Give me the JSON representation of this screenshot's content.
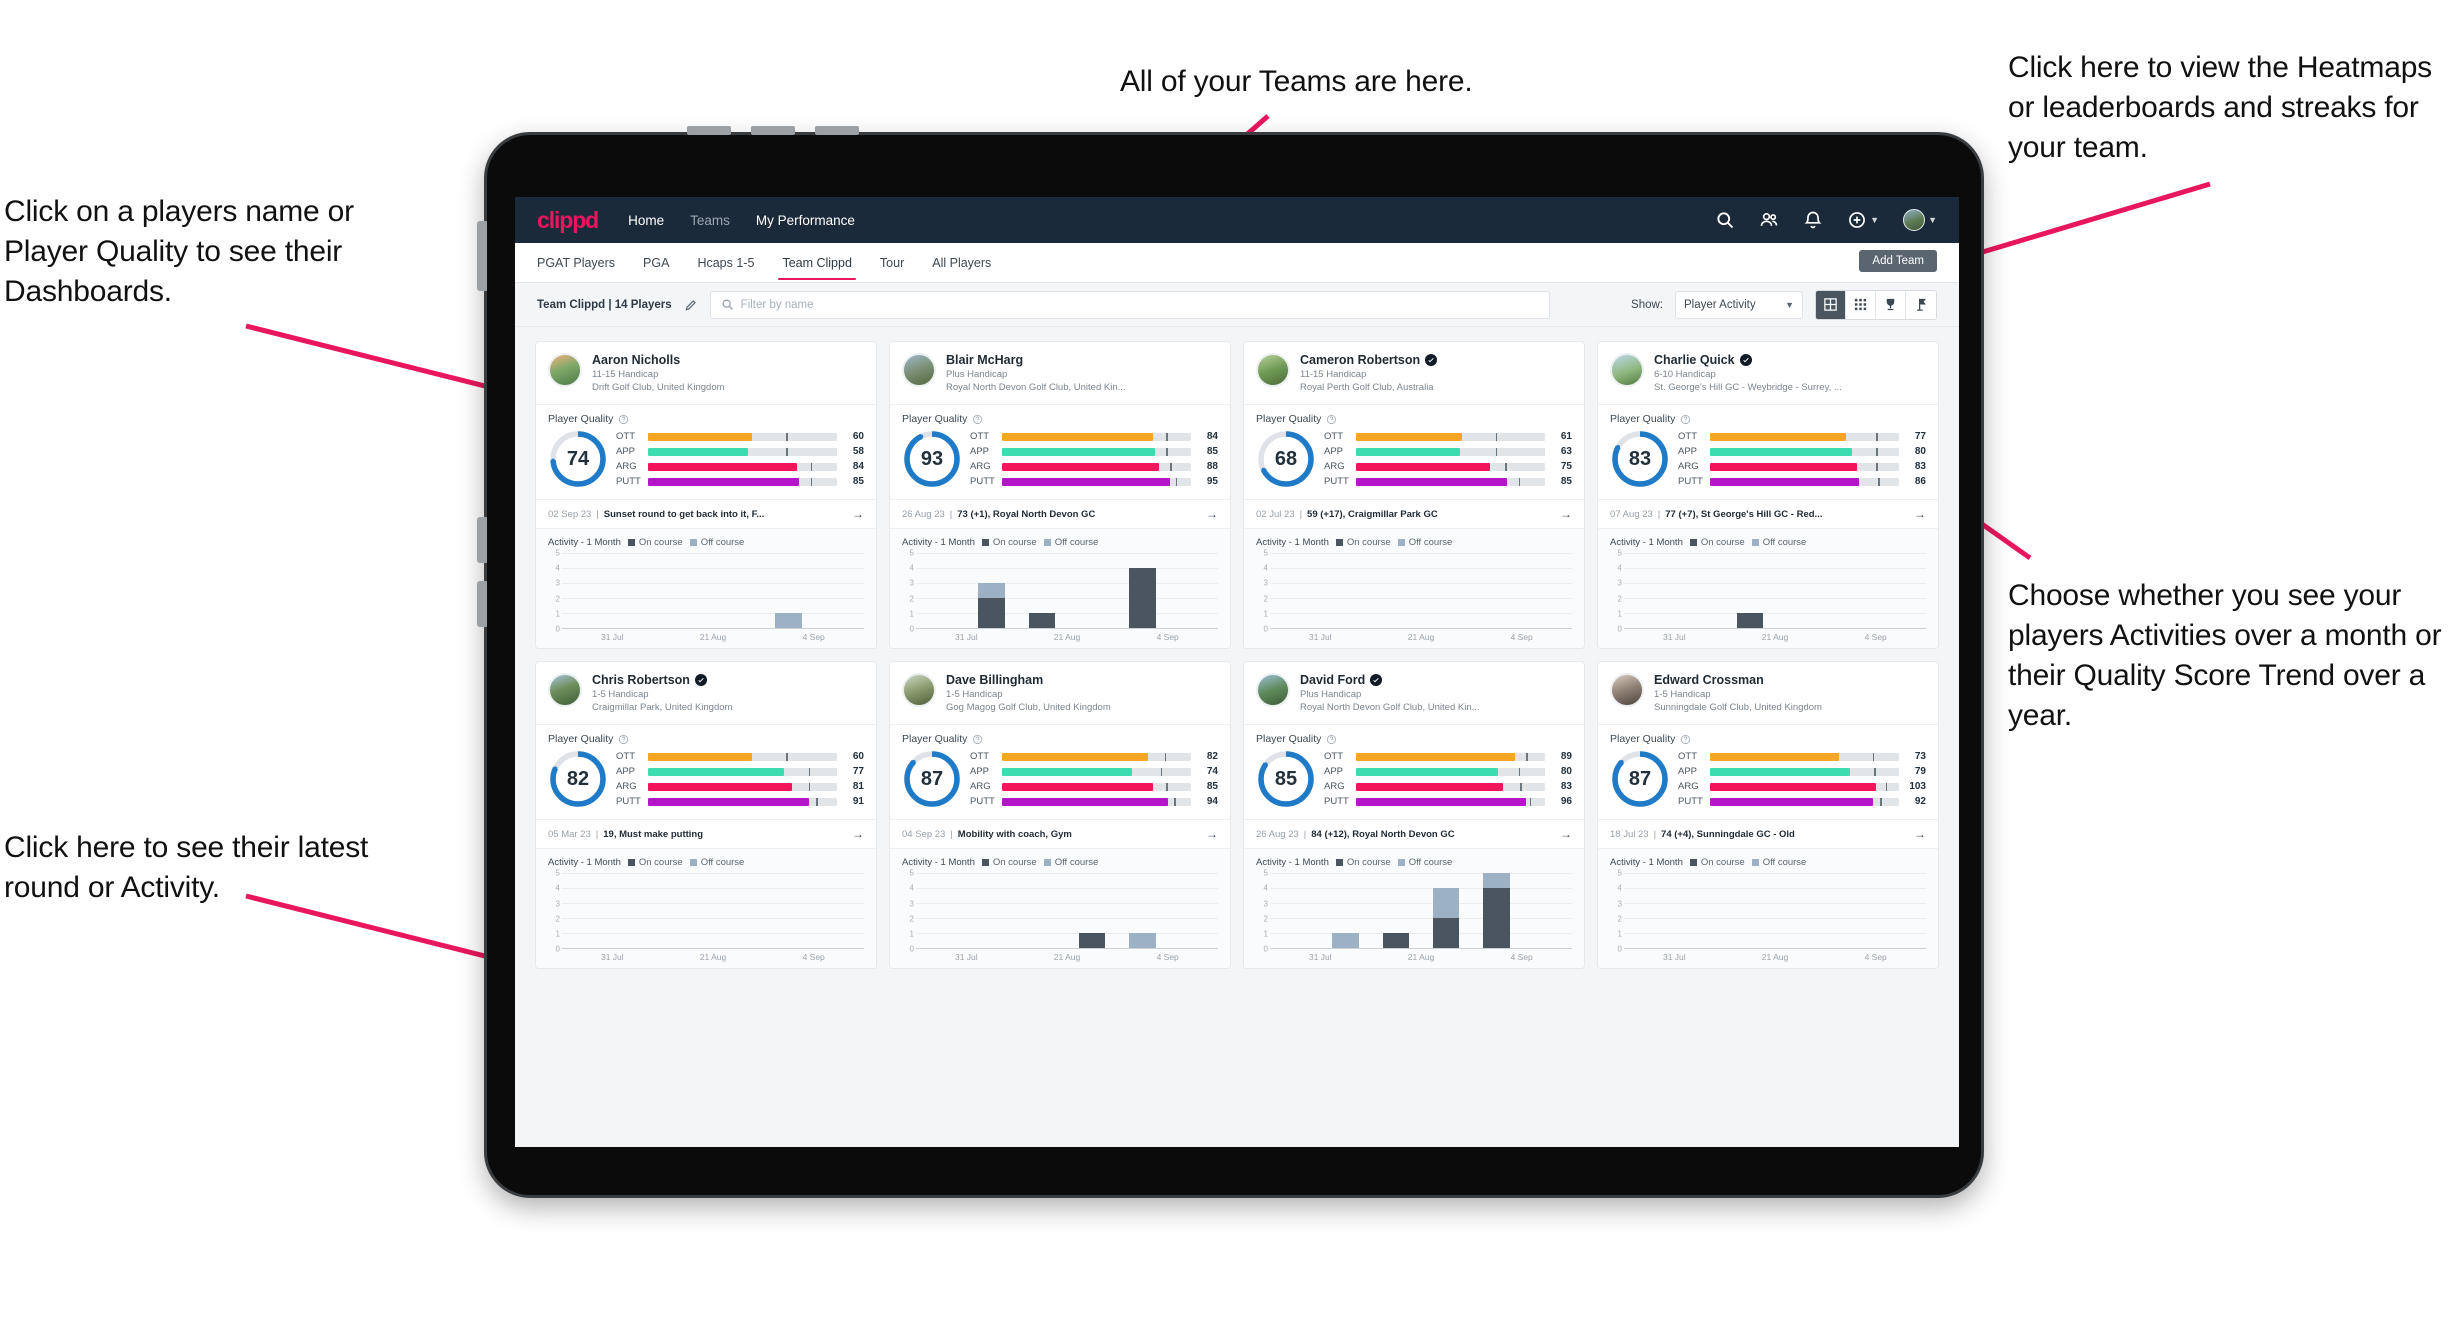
{
  "annotations": {
    "teams": "All of your Teams are here.",
    "heatmaps": "Click here to view the Heatmaps or leaderboards and streaks for your team.",
    "players": "Click on a players name or Player Quality to see their Dashboards.",
    "choose": "Choose whether you see your players Activities over a month or their Quality Score Trend over a year.",
    "latest": "Click here to see their latest round or Activity."
  },
  "navbar": {
    "logo": "clippd",
    "links": [
      {
        "label": "Home",
        "dim": false
      },
      {
        "label": "Teams",
        "dim": true
      },
      {
        "label": "My Performance",
        "dim": false
      }
    ],
    "icons": [
      "search-icon",
      "people-icon",
      "bell-icon",
      "plus-circle-icon",
      "avatar"
    ]
  },
  "tabs": {
    "items": [
      "PGAT Players",
      "PGA",
      "Hcaps 1-5",
      "Team Clippd",
      "Tour",
      "All Players"
    ],
    "active": "Team Clippd",
    "add_team_label": "Add Team"
  },
  "toolbar": {
    "team_label": "Team Clippd | 14 Players",
    "edit_icon": "pencil-icon",
    "search_placeholder": "Filter by name",
    "search_value": "",
    "show_label": "Show:",
    "show_value": "Player Activity",
    "views": [
      {
        "name": "grid-view-icon",
        "active": true
      },
      {
        "name": "table-view-icon",
        "active": false
      },
      {
        "name": "trophy-view-icon",
        "active": false
      },
      {
        "name": "flag-view-icon",
        "active": false
      }
    ]
  },
  "card_labels": {
    "player_quality": "Player Quality",
    "activity": "Activity - 1 Month",
    "legend_on": "On course",
    "legend_off": "Off course",
    "metric_names": [
      "OTT",
      "APP",
      "ARG",
      "PUTT"
    ]
  },
  "colors": {
    "brand_pink": "#e8175d",
    "navbar": "#1b2a3a",
    "ott": "#f5a623",
    "app": "#3ddbb0",
    "arg": "#f4145b",
    "putt": "#b515c9",
    "ring": "#1f7ac7",
    "on_course": "#4a555f",
    "off_course": "#9db1c4"
  },
  "chart_data": {
    "type": "bar",
    "title": "Activity - 1 Month",
    "xlabel": "",
    "ylabel": "",
    "ylim": [
      0,
      5
    ],
    "categories": [
      "31 Jul",
      "21 Aug",
      "4 Sep"
    ],
    "grid": true,
    "legend": [
      "On course",
      "Off course"
    ],
    "legend_position": "top"
  },
  "players": [
    {
      "name": "Aaron Nicholls",
      "verified": false,
      "handicap": "11-15 Handicap",
      "club": "Drift Golf Club, United Kingdom",
      "score": 74,
      "metrics": [
        {
          "label": "OTT",
          "value": 60,
          "fill": 55,
          "tick": 73
        },
        {
          "label": "APP",
          "value": 58,
          "fill": 53,
          "tick": 73
        },
        {
          "label": "ARG",
          "value": 84,
          "fill": 79,
          "tick": 86
        },
        {
          "label": "PUTT",
          "value": 85,
          "fill": 80,
          "tick": 86
        }
      ],
      "latest_date": "02 Sep 23",
      "latest_desc": "Sunset round to get back into it, F...",
      "bars": [
        {
          "on": 0,
          "off": 0
        },
        {
          "on": 0,
          "off": 0
        },
        {
          "on": 0,
          "off": 0
        },
        {
          "on": 0,
          "off": 0
        },
        {
          "on": 0,
          "off": 1
        },
        {
          "on": 0,
          "off": 0
        }
      ]
    },
    {
      "name": "Blair McHarg",
      "verified": false,
      "handicap": "Plus Handicap",
      "club": "Royal North Devon Golf Club, United Kin...",
      "score": 93,
      "metrics": [
        {
          "label": "OTT",
          "value": 84,
          "fill": 80,
          "tick": 87
        },
        {
          "label": "APP",
          "value": 85,
          "fill": 81,
          "tick": 87
        },
        {
          "label": "ARG",
          "value": 88,
          "fill": 83,
          "tick": 89
        },
        {
          "label": "PUTT",
          "value": 95,
          "fill": 89,
          "tick": 92
        }
      ],
      "latest_date": "26 Aug 23",
      "latest_desc": "73 (+1), Royal North Devon GC",
      "bars": [
        {
          "on": 0,
          "off": 0
        },
        {
          "on": 2,
          "off": 1
        },
        {
          "on": 1,
          "off": 0
        },
        {
          "on": 0,
          "off": 0
        },
        {
          "on": 4,
          "off": 0
        },
        {
          "on": 0,
          "off": 0
        }
      ]
    },
    {
      "name": "Cameron Robertson",
      "verified": true,
      "handicap": "11-15 Handicap",
      "club": "Royal Perth Golf Club, Australia",
      "score": 68,
      "metrics": [
        {
          "label": "OTT",
          "value": 61,
          "fill": 56,
          "tick": 74
        },
        {
          "label": "APP",
          "value": 63,
          "fill": 55,
          "tick": 74
        },
        {
          "label": "ARG",
          "value": 75,
          "fill": 71,
          "tick": 79
        },
        {
          "label": "PUTT",
          "value": 85,
          "fill": 80,
          "tick": 86
        }
      ],
      "latest_date": "02 Jul 23",
      "latest_desc": "59 (+17), Craigmillar Park GC",
      "bars": [
        {
          "on": 0,
          "off": 0
        },
        {
          "on": 0,
          "off": 0
        },
        {
          "on": 0,
          "off": 0
        },
        {
          "on": 0,
          "off": 0
        },
        {
          "on": 0,
          "off": 0
        },
        {
          "on": 0,
          "off": 0
        }
      ]
    },
    {
      "name": "Charlie Quick",
      "verified": true,
      "handicap": "6-10 Handicap",
      "club": "St. George's Hill GC - Weybridge - Surrey, ...",
      "score": 83,
      "metrics": [
        {
          "label": "OTT",
          "value": 77,
          "fill": 72,
          "tick": 88
        },
        {
          "label": "APP",
          "value": 80,
          "fill": 75,
          "tick": 88
        },
        {
          "label": "ARG",
          "value": 83,
          "fill": 78,
          "tick": 88
        },
        {
          "label": "PUTT",
          "value": 86,
          "fill": 79,
          "tick": 89
        }
      ],
      "latest_date": "07 Aug 23",
      "latest_desc": "77 (+7), St George's Hill GC - Red...",
      "bars": [
        {
          "on": 0,
          "off": 0
        },
        {
          "on": 0,
          "off": 0
        },
        {
          "on": 1,
          "off": 0
        },
        {
          "on": 0,
          "off": 0
        },
        {
          "on": 0,
          "off": 0
        },
        {
          "on": 0,
          "off": 0
        }
      ]
    },
    {
      "name": "Chris Robertson",
      "verified": true,
      "handicap": "1-5 Handicap",
      "club": "Craigmillar Park, United Kingdom",
      "score": 82,
      "metrics": [
        {
          "label": "OTT",
          "value": 60,
          "fill": 55,
          "tick": 73
        },
        {
          "label": "APP",
          "value": 77,
          "fill": 72,
          "tick": 85
        },
        {
          "label": "ARG",
          "value": 81,
          "fill": 76,
          "tick": 85
        },
        {
          "label": "PUTT",
          "value": 91,
          "fill": 85,
          "tick": 89
        }
      ],
      "latest_date": "05 Mar 23",
      "latest_desc": "19, Must make putting",
      "bars": [
        {
          "on": 0,
          "off": 0
        },
        {
          "on": 0,
          "off": 0
        },
        {
          "on": 0,
          "off": 0
        },
        {
          "on": 0,
          "off": 0
        },
        {
          "on": 0,
          "off": 0
        },
        {
          "on": 0,
          "off": 0
        }
      ]
    },
    {
      "name": "Dave Billingham",
      "verified": false,
      "handicap": "1-5 Handicap",
      "club": "Gog Magog Golf Club, United Kingdom",
      "score": 87,
      "metrics": [
        {
          "label": "OTT",
          "value": 82,
          "fill": 77,
          "tick": 86
        },
        {
          "label": "APP",
          "value": 74,
          "fill": 69,
          "tick": 84
        },
        {
          "label": "ARG",
          "value": 85,
          "fill": 80,
          "tick": 87
        },
        {
          "label": "PUTT",
          "value": 94,
          "fill": 88,
          "tick": 91
        }
      ],
      "latest_date": "04 Sep 23",
      "latest_desc": "Mobility with coach, Gym",
      "bars": [
        {
          "on": 0,
          "off": 0
        },
        {
          "on": 0,
          "off": 0
        },
        {
          "on": 0,
          "off": 0
        },
        {
          "on": 1,
          "off": 0
        },
        {
          "on": 0,
          "off": 1
        },
        {
          "on": 0,
          "off": 0
        }
      ]
    },
    {
      "name": "David Ford",
      "verified": true,
      "handicap": "Plus Handicap",
      "club": "Royal North Devon Golf Club, United Kin...",
      "score": 85,
      "metrics": [
        {
          "label": "OTT",
          "value": 89,
          "fill": 84,
          "tick": 90
        },
        {
          "label": "APP",
          "value": 80,
          "fill": 75,
          "tick": 86
        },
        {
          "label": "ARG",
          "value": 83,
          "fill": 78,
          "tick": 87
        },
        {
          "label": "PUTT",
          "value": 96,
          "fill": 90,
          "tick": 92
        }
      ],
      "latest_date": "26 Aug 23",
      "latest_desc": "84 (+12), Royal North Devon GC",
      "bars": [
        {
          "on": 0,
          "off": 0
        },
        {
          "on": 0,
          "off": 1
        },
        {
          "on": 1,
          "off": 0
        },
        {
          "on": 2,
          "off": 2
        },
        {
          "on": 4,
          "off": 1
        },
        {
          "on": 0,
          "off": 0
        }
      ]
    },
    {
      "name": "Edward Crossman",
      "verified": false,
      "handicap": "1-5 Handicap",
      "club": "Sunningdale Golf Club, United Kingdom",
      "score": 87,
      "metrics": [
        {
          "label": "OTT",
          "value": 73,
          "fill": 68,
          "tick": 86
        },
        {
          "label": "APP",
          "value": 79,
          "fill": 74,
          "tick": 87
        },
        {
          "label": "ARG",
          "value": 103,
          "fill": 88,
          "tick": 93
        },
        {
          "label": "PUTT",
          "value": 92,
          "fill": 86,
          "tick": 90
        }
      ],
      "latest_date": "18 Jul 23",
      "latest_desc": "74 (+4), Sunningdale GC - Old",
      "bars": [
        {
          "on": 0,
          "off": 0
        },
        {
          "on": 0,
          "off": 0
        },
        {
          "on": 0,
          "off": 0
        },
        {
          "on": 0,
          "off": 0
        },
        {
          "on": 0,
          "off": 0
        },
        {
          "on": 0,
          "off": 0
        }
      ]
    }
  ]
}
